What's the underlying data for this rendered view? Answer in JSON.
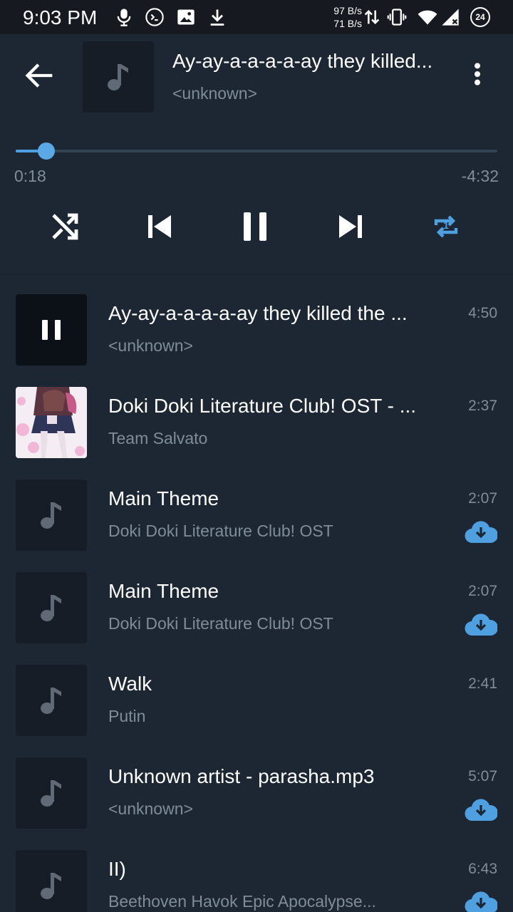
{
  "status_bar": {
    "time": "9:03 PM",
    "net_up": "97 B/s",
    "net_down": "71 B/s",
    "battery": "24",
    "icons": [
      "mic-icon",
      "terminal-icon",
      "image-icon",
      "download-icon",
      "data-arrows-icon",
      "vibrate-icon",
      "wifi-icon",
      "signal-icon",
      "battery-icon"
    ]
  },
  "player": {
    "title": "Ay-ay-a-a-a-a-ay they killed...",
    "artist": "<unknown>",
    "elapsed": "0:18",
    "remaining": "-4:32",
    "progress": 0.064,
    "repeat_badge": "1",
    "accent_color": "#4ea0e0"
  },
  "playlist": [
    {
      "title": "Ay-ay-a-a-a-a-ay they killed the ...",
      "subtitle": "<unknown>",
      "duration": "4:50",
      "playing": true,
      "download": false,
      "art": "pause"
    },
    {
      "title": "Doki Doki Literature Club! OST - ...",
      "subtitle": "Team Salvato",
      "duration": "2:37",
      "playing": false,
      "download": false,
      "art": "image"
    },
    {
      "title": "Main Theme",
      "subtitle": "Doki Doki Literature Club! OST",
      "duration": "2:07",
      "playing": false,
      "download": true,
      "art": "note"
    },
    {
      "title": "Main Theme",
      "subtitle": "Doki Doki Literature Club! OST",
      "duration": "2:07",
      "playing": false,
      "download": true,
      "art": "note"
    },
    {
      "title": "Walk",
      "subtitle": "Putin",
      "duration": "2:41",
      "playing": false,
      "download": false,
      "art": "note"
    },
    {
      "title": "Unknown artist - parasha.mp3",
      "subtitle": "<unknown>",
      "duration": "5:07",
      "playing": false,
      "download": true,
      "art": "note"
    },
    {
      "title": "II)",
      "subtitle": "Beethoven Havok Epic Apocalypse...",
      "duration": "6:43",
      "playing": false,
      "download": true,
      "art": "note"
    }
  ]
}
